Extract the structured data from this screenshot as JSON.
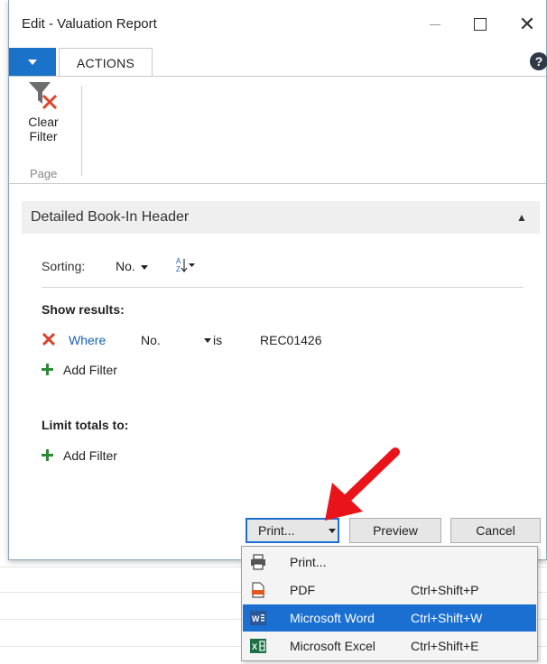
{
  "window": {
    "title": "Edit - Valuation Report"
  },
  "ribbon": {
    "tab_label": "ACTIONS",
    "clear_filter_line1": "Clear",
    "clear_filter_line2": "Filter",
    "group_label": "Page"
  },
  "section": {
    "title": "Detailed Book-In Header"
  },
  "sorting": {
    "label": "Sorting:",
    "field": "No."
  },
  "show_results": {
    "label": "Show results:",
    "filter": {
      "keyword": "Where",
      "field": "No.",
      "operator": "is",
      "value": "REC01426"
    },
    "add_filter_label": "Add Filter"
  },
  "limit_totals": {
    "label": "Limit totals to:",
    "add_filter_label": "Add Filter"
  },
  "buttons": {
    "print": "Print...",
    "preview": "Preview",
    "cancel": "Cancel"
  },
  "print_menu": {
    "items": [
      {
        "label": "Print...",
        "shortcut": "",
        "icon": "printer-icon"
      },
      {
        "label": "PDF",
        "shortcut": "Ctrl+Shift+P",
        "icon": "pdf-icon"
      },
      {
        "label": "Microsoft Word",
        "shortcut": "Ctrl+Shift+W",
        "icon": "word-icon"
      },
      {
        "label": "Microsoft Excel",
        "shortcut": "Ctrl+Shift+E",
        "icon": "excel-icon"
      }
    ],
    "selected_index": 2
  },
  "colors": {
    "accent": "#1a6fd1",
    "link": "#1a5fb4",
    "remove_red": "#d9412b",
    "add_green": "#2e8b3a",
    "annotation_arrow": "#e8141a"
  }
}
